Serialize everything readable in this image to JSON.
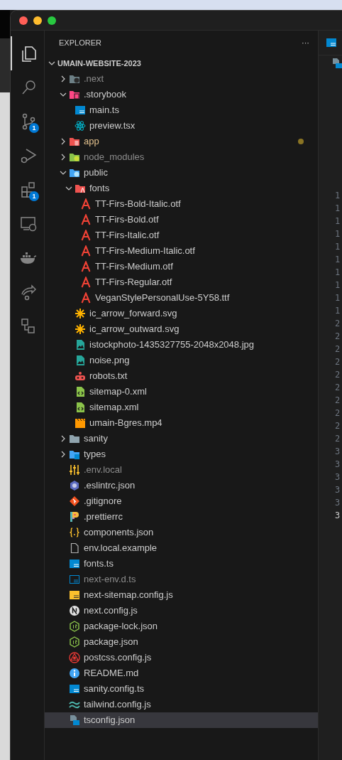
{
  "activity_bar": [
    {
      "kind": "files",
      "selected": true
    },
    {
      "kind": "search",
      "selected": false
    },
    {
      "kind": "source-control",
      "selected": false,
      "badge": "1"
    },
    {
      "kind": "run-debug",
      "selected": false
    },
    {
      "kind": "extensions",
      "selected": false,
      "badge": "1"
    },
    {
      "kind": "remote",
      "selected": false
    },
    {
      "kind": "docker",
      "selected": false
    },
    {
      "kind": "live-share",
      "selected": false
    },
    {
      "kind": "graph",
      "selected": false
    }
  ],
  "explorer": {
    "title": "EXPLORER",
    "more": "···",
    "root": {
      "label": "UMAIN-WEBSITE-2023",
      "expanded": true,
      "children": [
        {
          "label": ".next",
          "kind": "folder-next",
          "expanded": false,
          "dimmed": true,
          "modified": false,
          "selected": false
        },
        {
          "label": ".storybook",
          "kind": "folder-storybook",
          "expanded": true,
          "dimmed": false,
          "modified": false,
          "selected": false,
          "children": [
            {
              "label": "main.ts",
              "kind": "ts",
              "dimmed": false,
              "modified": false,
              "selected": false
            },
            {
              "label": "preview.tsx",
              "kind": "react",
              "dimmed": false,
              "modified": false,
              "selected": false
            }
          ]
        },
        {
          "label": "app",
          "kind": "folder-app",
          "expanded": false,
          "dimmed": false,
          "modified": true,
          "selected": false
        },
        {
          "label": "node_modules",
          "kind": "folder-node",
          "expanded": false,
          "dimmed": true,
          "modified": false,
          "selected": false
        },
        {
          "label": "public",
          "kind": "folder-public",
          "expanded": true,
          "dimmed": false,
          "modified": false,
          "selected": false,
          "children": [
            {
              "label": "fonts",
              "kind": "folder-fonts",
              "expanded": true,
              "dimmed": false,
              "modified": false,
              "selected": false,
              "children": [
                {
                  "label": "TT-Firs-Bold-Italic.otf",
                  "kind": "font",
                  "dimmed": false,
                  "modified": false,
                  "selected": false
                },
                {
                  "label": "TT-Firs-Bold.otf",
                  "kind": "font",
                  "dimmed": false,
                  "modified": false,
                  "selected": false
                },
                {
                  "label": "TT-Firs-Italic.otf",
                  "kind": "font",
                  "dimmed": false,
                  "modified": false,
                  "selected": false
                },
                {
                  "label": "TT-Firs-Medium-Italic.otf",
                  "kind": "font",
                  "dimmed": false,
                  "modified": false,
                  "selected": false
                },
                {
                  "label": "TT-Firs-Medium.otf",
                  "kind": "font",
                  "dimmed": false,
                  "modified": false,
                  "selected": false
                },
                {
                  "label": "TT-Firs-Regular.otf",
                  "kind": "font",
                  "dimmed": false,
                  "modified": false,
                  "selected": false
                },
                {
                  "label": "VeganStylePersonalUse-5Y58.ttf",
                  "kind": "font",
                  "dimmed": false,
                  "modified": false,
                  "selected": false
                }
              ]
            },
            {
              "label": "ic_arrow_forward.svg",
              "kind": "svg",
              "dimmed": false,
              "modified": false,
              "selected": false
            },
            {
              "label": "ic_arrow_outward.svg",
              "kind": "svg",
              "dimmed": false,
              "modified": false,
              "selected": false
            },
            {
              "label": "istockphoto-1435327755-2048x2048.jpg",
              "kind": "image",
              "dimmed": false,
              "modified": false,
              "selected": false
            },
            {
              "label": "noise.png",
              "kind": "image",
              "dimmed": false,
              "modified": false,
              "selected": false
            },
            {
              "label": "robots.txt",
              "kind": "robot",
              "dimmed": false,
              "modified": false,
              "selected": false
            },
            {
              "label": "sitemap-0.xml",
              "kind": "xml",
              "dimmed": false,
              "modified": false,
              "selected": false
            },
            {
              "label": "sitemap.xml",
              "kind": "xml",
              "dimmed": false,
              "modified": false,
              "selected": false
            },
            {
              "label": "umain-Bgres.mp4",
              "kind": "video",
              "dimmed": false,
              "modified": false,
              "selected": false
            }
          ]
        },
        {
          "label": "sanity",
          "kind": "folder-plain",
          "expanded": false,
          "dimmed": false,
          "modified": false,
          "selected": false
        },
        {
          "label": "types",
          "kind": "folder-types",
          "expanded": false,
          "dimmed": false,
          "modified": false,
          "selected": false
        },
        {
          "label": ".env.local",
          "kind": "env",
          "dimmed": true,
          "modified": false,
          "selected": false
        },
        {
          "label": ".eslintrc.json",
          "kind": "eslint",
          "dimmed": false,
          "modified": false,
          "selected": false
        },
        {
          "label": ".gitignore",
          "kind": "git",
          "dimmed": false,
          "modified": false,
          "selected": false
        },
        {
          "label": ".prettierrc",
          "kind": "prettier",
          "dimmed": false,
          "modified": false,
          "selected": false
        },
        {
          "label": "components.json",
          "kind": "json",
          "dimmed": false,
          "modified": false,
          "selected": false
        },
        {
          "label": "env.local.example",
          "kind": "file",
          "dimmed": false,
          "modified": false,
          "selected": false
        },
        {
          "label": "fonts.ts",
          "kind": "ts",
          "dimmed": false,
          "modified": false,
          "selected": false
        },
        {
          "label": "next-env.d.ts",
          "kind": "ts-def",
          "dimmed": true,
          "modified": false,
          "selected": false
        },
        {
          "label": "next-sitemap.config.js",
          "kind": "js",
          "dimmed": false,
          "modified": false,
          "selected": false
        },
        {
          "label": "next.config.js",
          "kind": "next",
          "dimmed": false,
          "modified": false,
          "selected": false
        },
        {
          "label": "package-lock.json",
          "kind": "node",
          "dimmed": false,
          "modified": false,
          "selected": false
        },
        {
          "label": "package.json",
          "kind": "node",
          "dimmed": false,
          "modified": false,
          "selected": false
        },
        {
          "label": "postcss.config.js",
          "kind": "postcss",
          "dimmed": false,
          "modified": false,
          "selected": false
        },
        {
          "label": "README.md",
          "kind": "info",
          "dimmed": false,
          "modified": false,
          "selected": false
        },
        {
          "label": "sanity.config.ts",
          "kind": "ts",
          "dimmed": false,
          "modified": false,
          "selected": false
        },
        {
          "label": "tailwind.config.js",
          "kind": "tailwind",
          "dimmed": false,
          "modified": false,
          "selected": false
        },
        {
          "label": "tsconfig.json",
          "kind": "tsconfig",
          "dimmed": false,
          "modified": false,
          "selected": true
        }
      ]
    }
  },
  "editor": {
    "line_numbers": [
      {
        "text": "1",
        "current": false
      },
      {
        "text": "1",
        "current": false
      },
      {
        "text": "1",
        "current": false
      },
      {
        "text": "1",
        "current": false
      },
      {
        "text": "1",
        "current": false
      },
      {
        "text": "1",
        "current": false
      },
      {
        "text": "1",
        "current": false
      },
      {
        "text": "1",
        "current": false
      },
      {
        "text": "1",
        "current": false
      },
      {
        "text": "1",
        "current": false
      },
      {
        "text": "2",
        "current": false
      },
      {
        "text": "2",
        "current": false
      },
      {
        "text": "2",
        "current": false
      },
      {
        "text": "2",
        "current": false
      },
      {
        "text": "2",
        "current": false
      },
      {
        "text": "2",
        "current": false
      },
      {
        "text": "2",
        "current": false
      },
      {
        "text": "2",
        "current": false
      },
      {
        "text": "2",
        "current": false
      },
      {
        "text": "2",
        "current": false
      },
      {
        "text": "3",
        "current": false
      },
      {
        "text": "3",
        "current": false
      },
      {
        "text": "3",
        "current": false
      },
      {
        "text": "3",
        "current": false
      },
      {
        "text": "3",
        "current": false
      },
      {
        "text": "3",
        "current": true
      }
    ]
  }
}
